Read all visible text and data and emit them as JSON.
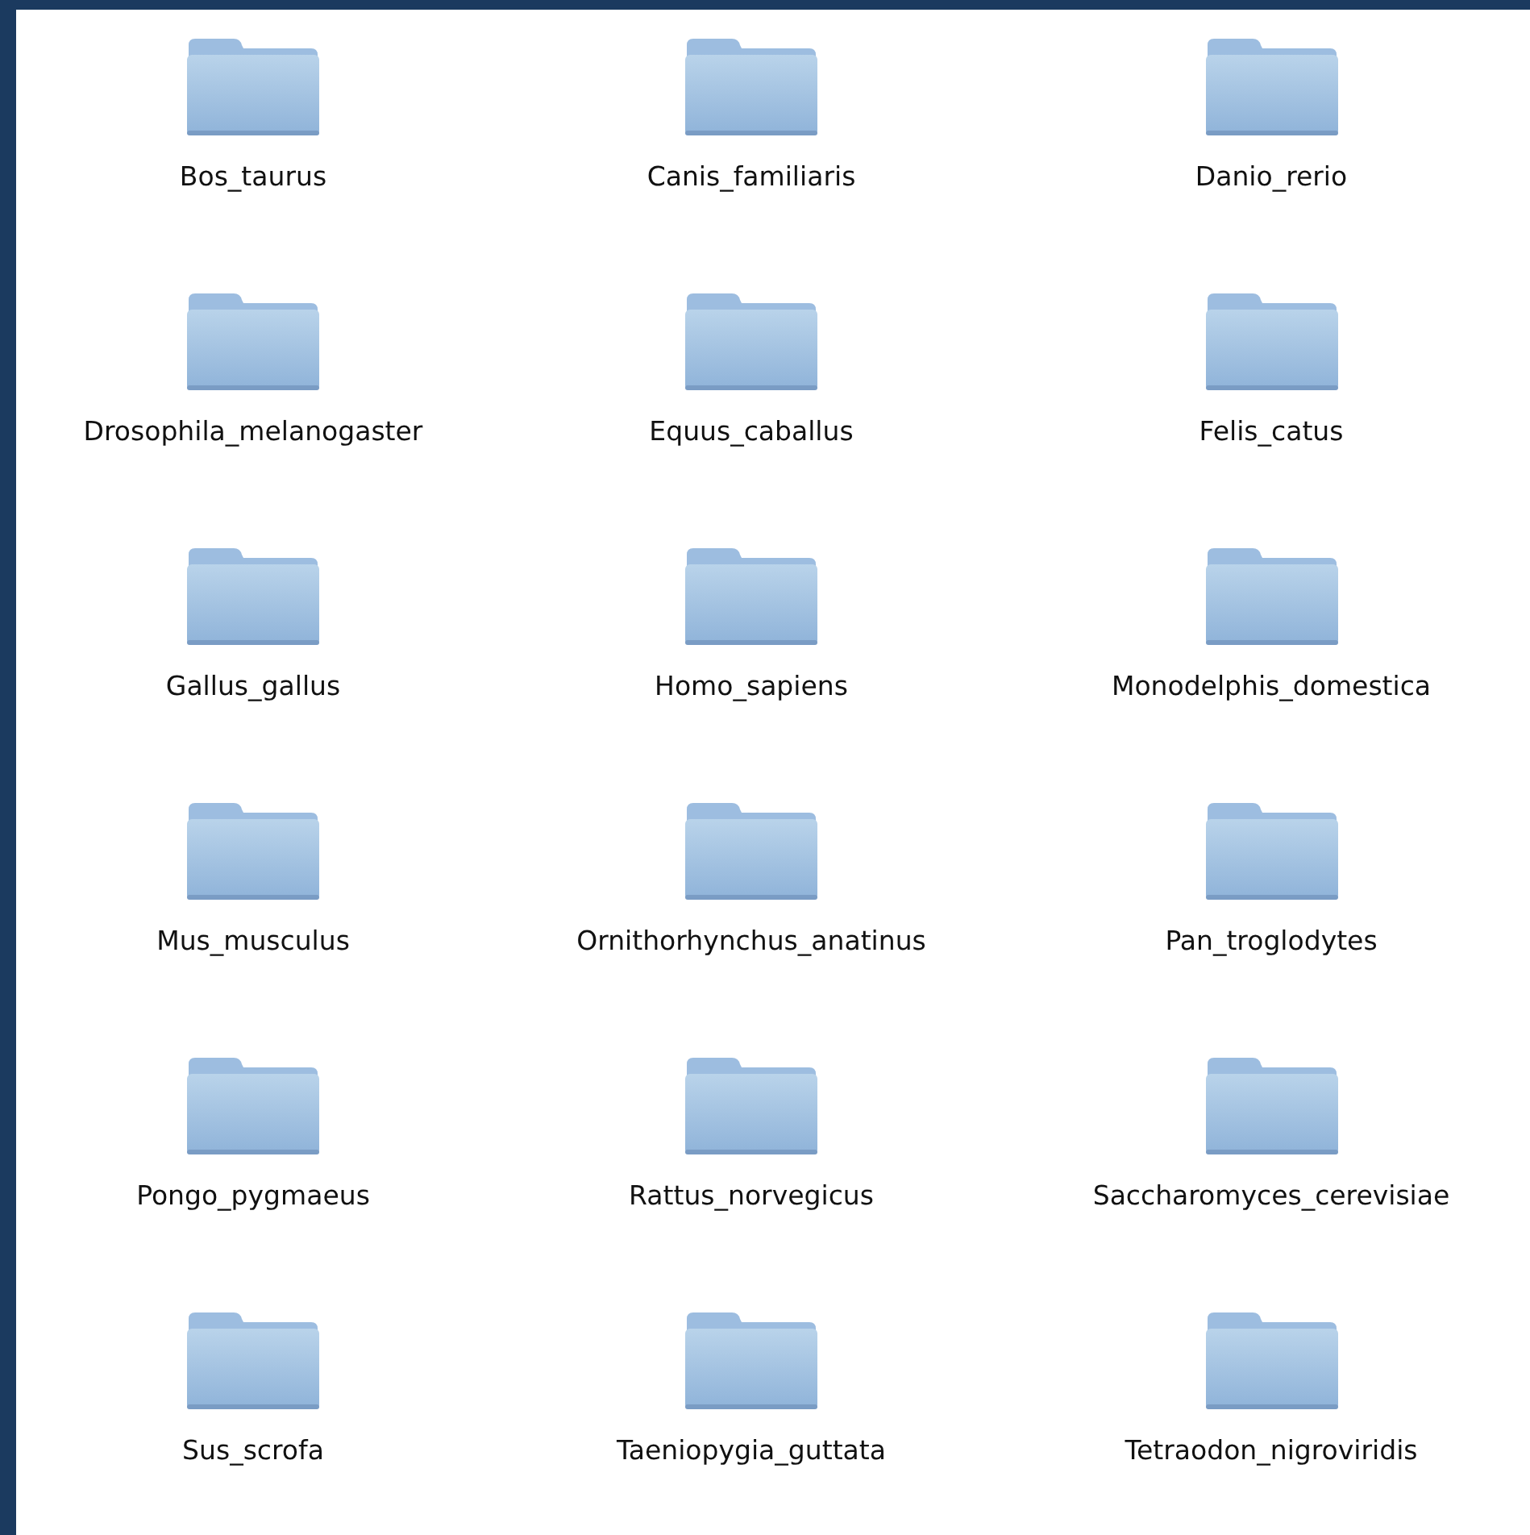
{
  "folders": [
    {
      "name": "Bos_taurus"
    },
    {
      "name": "Canis_familiaris"
    },
    {
      "name": "Danio_rerio"
    },
    {
      "name": "Drosophila_melanogaster"
    },
    {
      "name": "Equus_caballus"
    },
    {
      "name": "Felis_catus"
    },
    {
      "name": "Gallus_gallus"
    },
    {
      "name": "Homo_sapiens"
    },
    {
      "name": "Monodelphis_domestica"
    },
    {
      "name": "Mus_musculus"
    },
    {
      "name": "Ornithorhynchus_anatinus"
    },
    {
      "name": "Pan_troglodytes"
    },
    {
      "name": "Pongo_pygmaeus"
    },
    {
      "name": "Rattus_norvegicus"
    },
    {
      "name": "Saccharomyces_cerevisiae"
    },
    {
      "name": "Sus_scrofa"
    },
    {
      "name": "Taeniopygia_guttata"
    },
    {
      "name": "Tetraodon_nigroviridis"
    }
  ]
}
